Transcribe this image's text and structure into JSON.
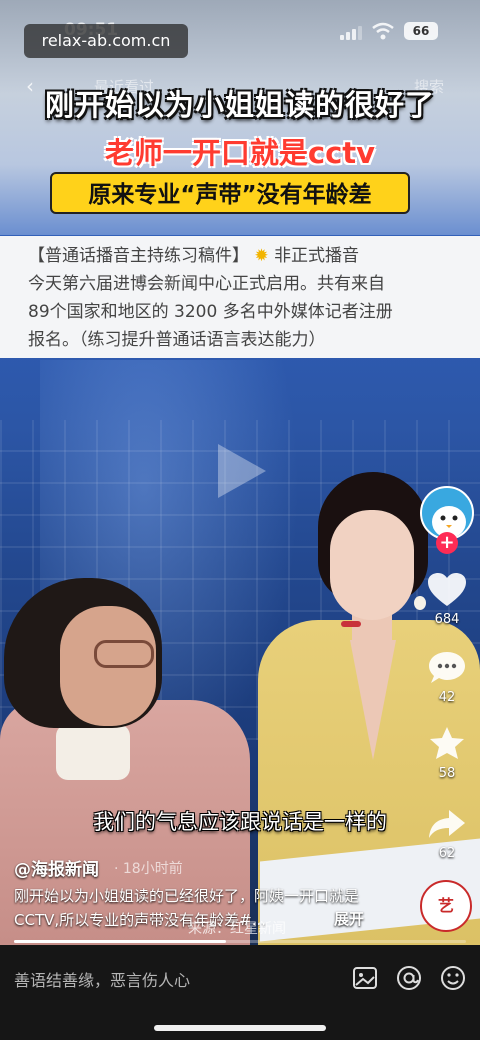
{
  "status_bar": {
    "time": "09:51",
    "battery": "66"
  },
  "watermark": "relax-ab.com.cn",
  "top_nav": {
    "recent": "最近看过",
    "search": "搜索"
  },
  "captions": {
    "main": "刚开始以为小姐姐读的很好了",
    "red": "老师一开口就是cctv",
    "yellow": "原来专业“声带”没有年龄差"
  },
  "text_card": {
    "line1": "【普通话播音主持练习稿件】",
    "line1_badge": "非正式播音",
    "line2": "今天第六届进博会新闻中心正式启用。共有来自",
    "line3": "89个国家和地区的 3200 多名中外媒体记者注册",
    "line4": "报名。（练习提升普通话语言表达能力）"
  },
  "subtitle": "我们的气息应该跟说话是一样的",
  "rail": {
    "likes": "684",
    "comments": "42",
    "favorites": "58",
    "shares": "62"
  },
  "post": {
    "author": "@海报新闻",
    "time": "· 18小时前",
    "description": "刚开始以为小姐姐读的已经很好了，阿姨一开口就是CCTV,所以专业的声带没有年龄差#...",
    "expand": "展开",
    "source": "来源：红星新闻",
    "stamp": "艺"
  },
  "progress": 0.47,
  "comment_bar": {
    "placeholder": "善语结善缘，恶言伤人心"
  },
  "colors": {
    "accent_red": "#fe2c55",
    "banner_yellow": "#ffd21a",
    "caption_red": "#ff3b30"
  }
}
